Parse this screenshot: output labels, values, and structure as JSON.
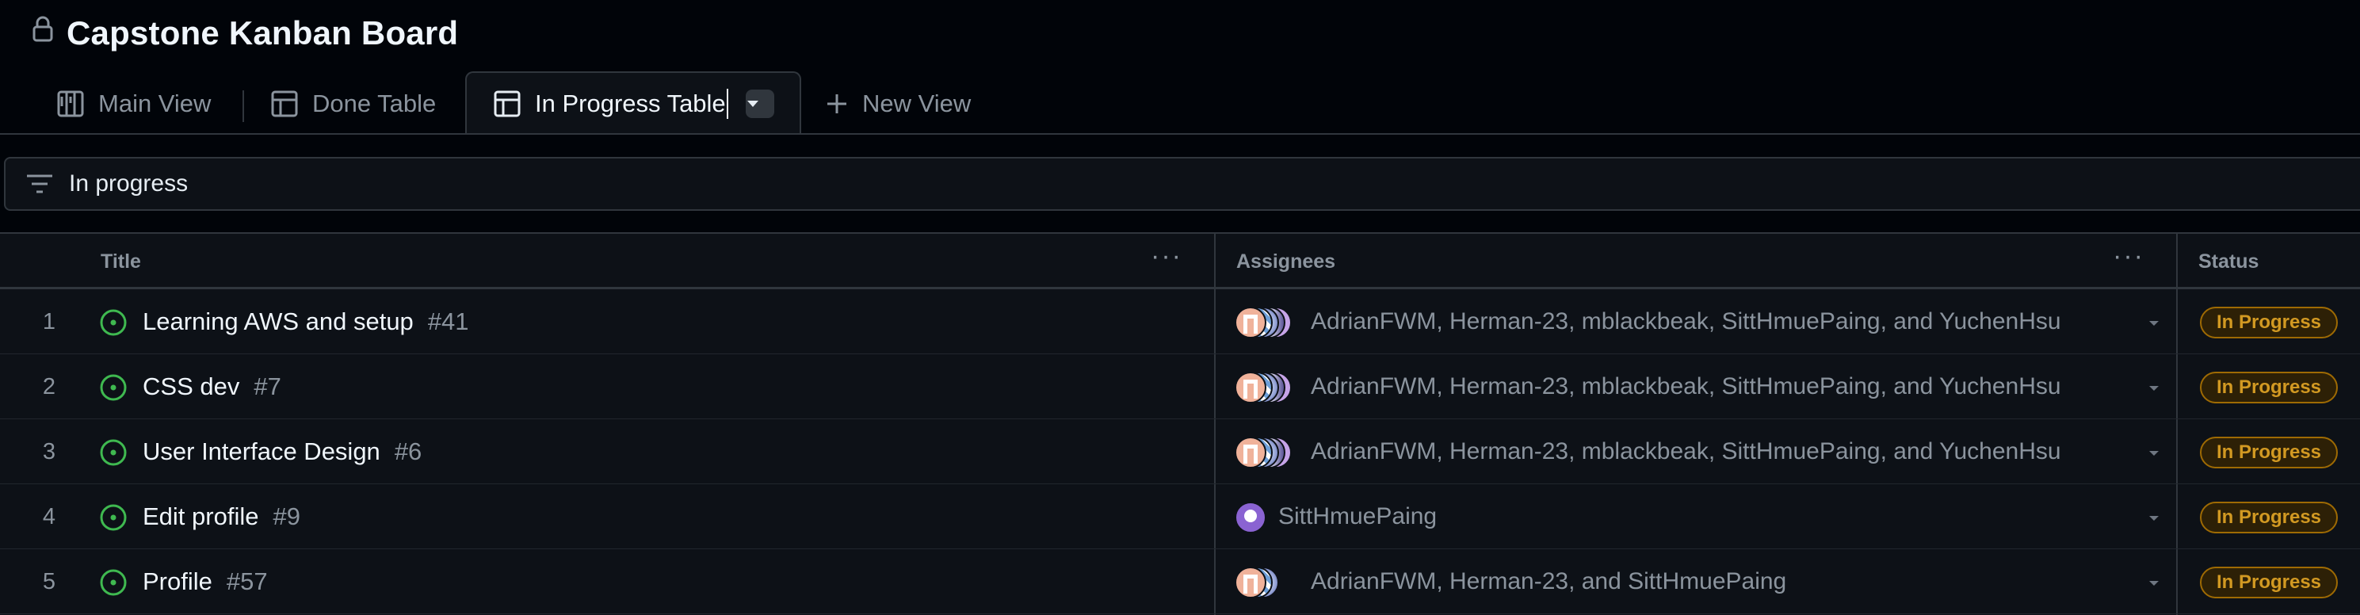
{
  "project": {
    "title": "Capstone Kanban Board"
  },
  "tabs": [
    {
      "label": "Main View",
      "icon": "board-icon"
    },
    {
      "label": "Done Table",
      "icon": "table-icon"
    },
    {
      "label": "In Progress Table",
      "icon": "table-icon",
      "active": true
    },
    {
      "label": "New View",
      "icon": "plus-icon"
    }
  ],
  "filter": {
    "value": "In progress",
    "icon": "filter-icon"
  },
  "columns": {
    "title": "Title",
    "assignees": "Assignees",
    "status": "Status"
  },
  "rows": [
    {
      "index": "1",
      "title": "Learning AWS and setup",
      "issue": "#41",
      "assignees": "AdrianFWM, Herman-23, mblackbeak, SittHmuePaing, and YuchenHsu",
      "status": "In Progress"
    },
    {
      "index": "2",
      "title": "CSS dev",
      "issue": "#7",
      "assignees": "AdrianFWM, Herman-23, mblackbeak, SittHmuePaing, and YuchenHsu",
      "status": "In Progress"
    },
    {
      "index": "3",
      "title": "User Interface Design",
      "issue": "#6",
      "assignees": "AdrianFWM, Herman-23, mblackbeak, SittHmuePaing, and YuchenHsu",
      "status": "In Progress"
    },
    {
      "index": "4",
      "title": "Edit profile",
      "issue": "#9",
      "assignees": "SittHmuePaing",
      "status": "In Progress"
    },
    {
      "index": "5",
      "title": "Profile",
      "issue": "#57",
      "assignees": "AdrianFWM, Herman-23, and SittHmuePaing",
      "status": "In Progress"
    }
  ],
  "colors": {
    "background": "#010409",
    "surface": "#0d1117",
    "border": "#30363d",
    "open_issue_green": "#3fb950",
    "status_in_progress": "#d29922"
  }
}
